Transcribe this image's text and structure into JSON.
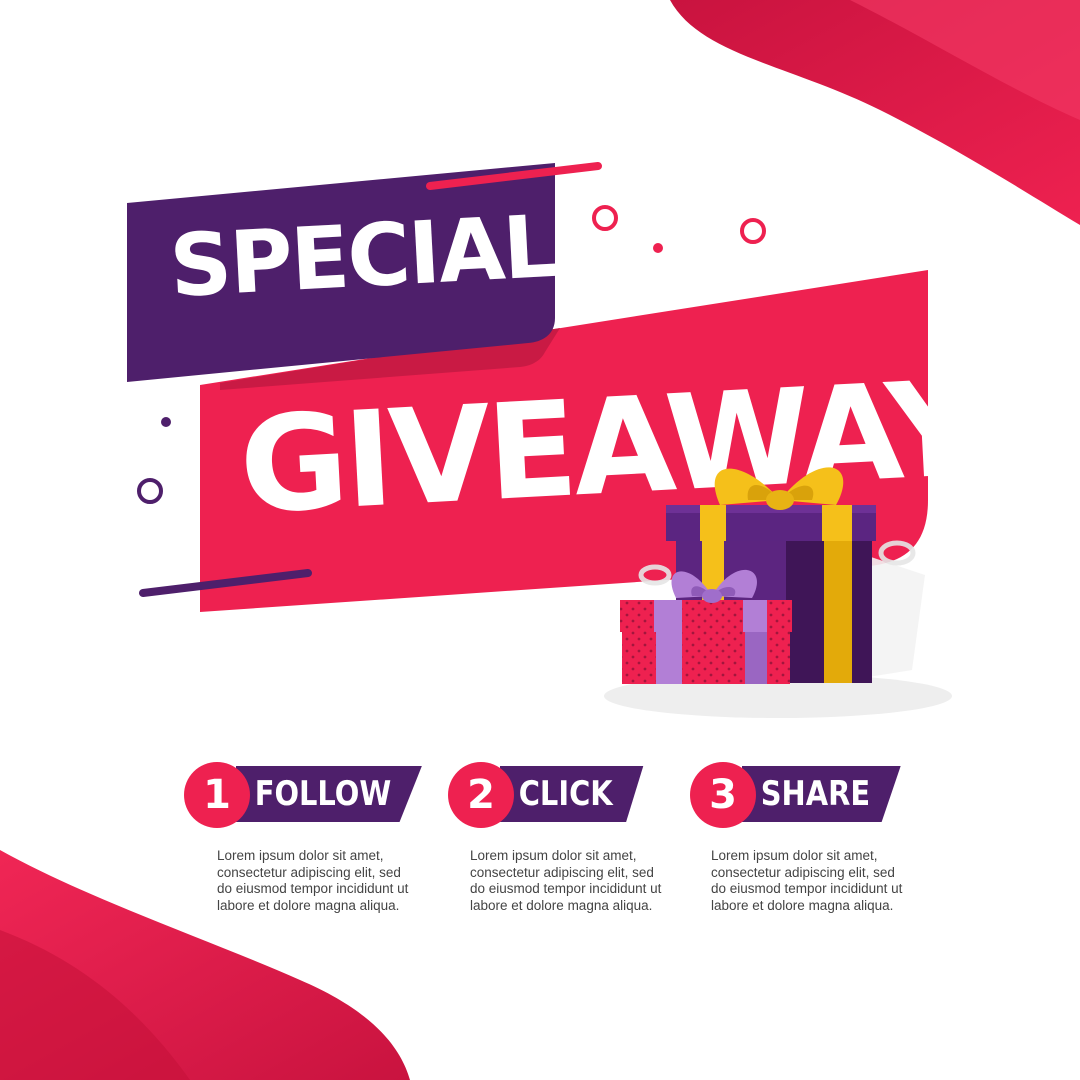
{
  "headline": {
    "line1": "SPECIAL",
    "line2": "GIVEAWAY"
  },
  "steps": [
    {
      "number": "1",
      "label": "FOLLOW",
      "text": "Lorem ipsum dolor sit amet, consectetur adipiscing elit, sed do eiusmod tempor incididunt ut labore et dolore magna aliqua."
    },
    {
      "number": "2",
      "label": "CLICK",
      "text": "Lorem ipsum dolor sit amet, consectetur adipiscing elit, sed do eiusmod tempor incididunt ut labore et dolore magna aliqua."
    },
    {
      "number": "3",
      "label": "SHARE",
      "text": "Lorem ipsum dolor sit amet, consectetur adipiscing elit, sed do eiusmod tempor incididunt ut labore et dolore magna aliqua."
    }
  ],
  "colors": {
    "crimson": "#ee2150",
    "purple": "#4e1f6b",
    "gold": "#f5c01a",
    "lavender": "#b27fd6",
    "text_gray": "#444444"
  },
  "icons": [
    "gift-box-icon",
    "gift-box-small-icon",
    "ring-decoration-icon",
    "dot-decoration-icon"
  ]
}
